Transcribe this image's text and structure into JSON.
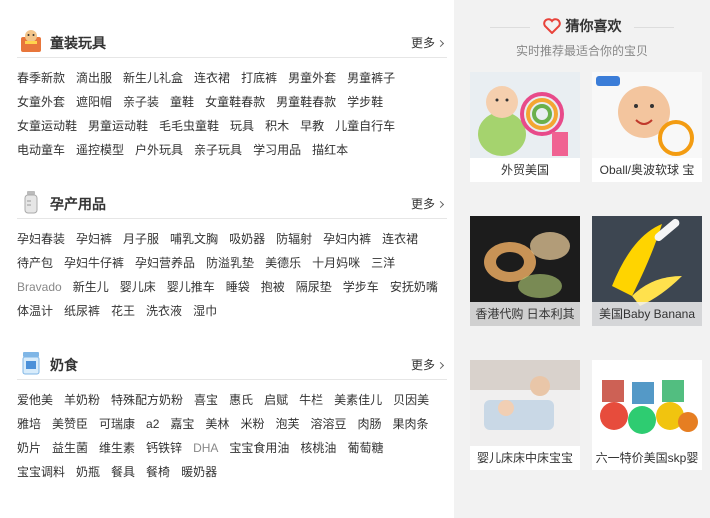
{
  "sections": [
    {
      "title": "童装玩具",
      "icon": "toy-kids-icon",
      "more": "更多",
      "items": [
        "春季新款",
        "滴出服",
        "新生儿礼盒",
        "连衣裙",
        "打底裤",
        "男童外套",
        "男童裤子",
        "女童外套",
        "遮阳帽",
        "亲子装",
        "童鞋",
        "女童鞋春款",
        "男童鞋春款",
        "学步鞋",
        "女童运动鞋",
        "男童运动鞋",
        "毛毛虫童鞋",
        "玩具",
        "积木",
        "早教",
        "儿童自行车",
        "电动童车",
        "遥控模型",
        "户外玩具",
        "亲子玩具",
        "学习用品",
        "描红本"
      ]
    },
    {
      "title": "孕产用品",
      "icon": "maternity-bottle-icon",
      "more": "更多",
      "items": [
        "孕妇春装",
        "孕妇裤",
        "月子服",
        "哺乳文胸",
        "吸奶器",
        "防辐射",
        "孕妇内裤",
        "连衣裙",
        "待产包",
        "孕妇牛仔裤",
        "孕妇营养品",
        "防溢乳垫",
        "美德乐",
        "十月妈咪",
        "三洋",
        "Bravado",
        "新生儿",
        "婴儿床",
        "婴儿推车",
        "睡袋",
        "抱被",
        "隔尿垫",
        "学步车",
        "安抚奶嘴",
        "体温计",
        "纸尿裤",
        "花王",
        "洗衣液",
        "湿巾"
      ]
    },
    {
      "title": "奶食",
      "icon": "milk-powder-icon",
      "more": "更多",
      "items": [
        "爱他美",
        "羊奶粉",
        "特殊配方奶粉",
        "喜宝",
        "惠氏",
        "启赋",
        "牛栏",
        "美素佳儿",
        "贝因美",
        "雅培",
        "美赞臣",
        "可瑞康",
        "a2",
        "嘉宝",
        "美林",
        "米粉",
        "泡芙",
        "溶溶豆",
        "肉肠",
        "果肉条",
        "奶片",
        "益生菌",
        "维生素",
        "钙铁锌",
        "DHA",
        "宝宝食用油",
        "核桃油",
        "葡萄糖",
        "宝宝调料",
        "奶瓶",
        "餐具",
        "餐椅",
        "暖奶器"
      ]
    }
  ],
  "recommend": {
    "title": "猜你喜欢",
    "subtitle": "实时推荐最适合你的宝贝",
    "accent": "#e8433b",
    "products": [
      {
        "caption": "外贸美国",
        "icon": "baby-with-toy-image"
      },
      {
        "caption": "Oball/奥波软球 宝",
        "icon": "oball-baby-image"
      },
      {
        "caption": "香港代购 日本利其",
        "icon": "teether-image"
      },
      {
        "caption": "美国Baby Banana",
        "icon": "banana-toothbrush-image"
      },
      {
        "caption": "婴儿床床中床宝宝",
        "icon": "baby-bed-image"
      },
      {
        "caption": "六一特价美国skp婴",
        "icon": "skp-balls-image"
      }
    ]
  }
}
